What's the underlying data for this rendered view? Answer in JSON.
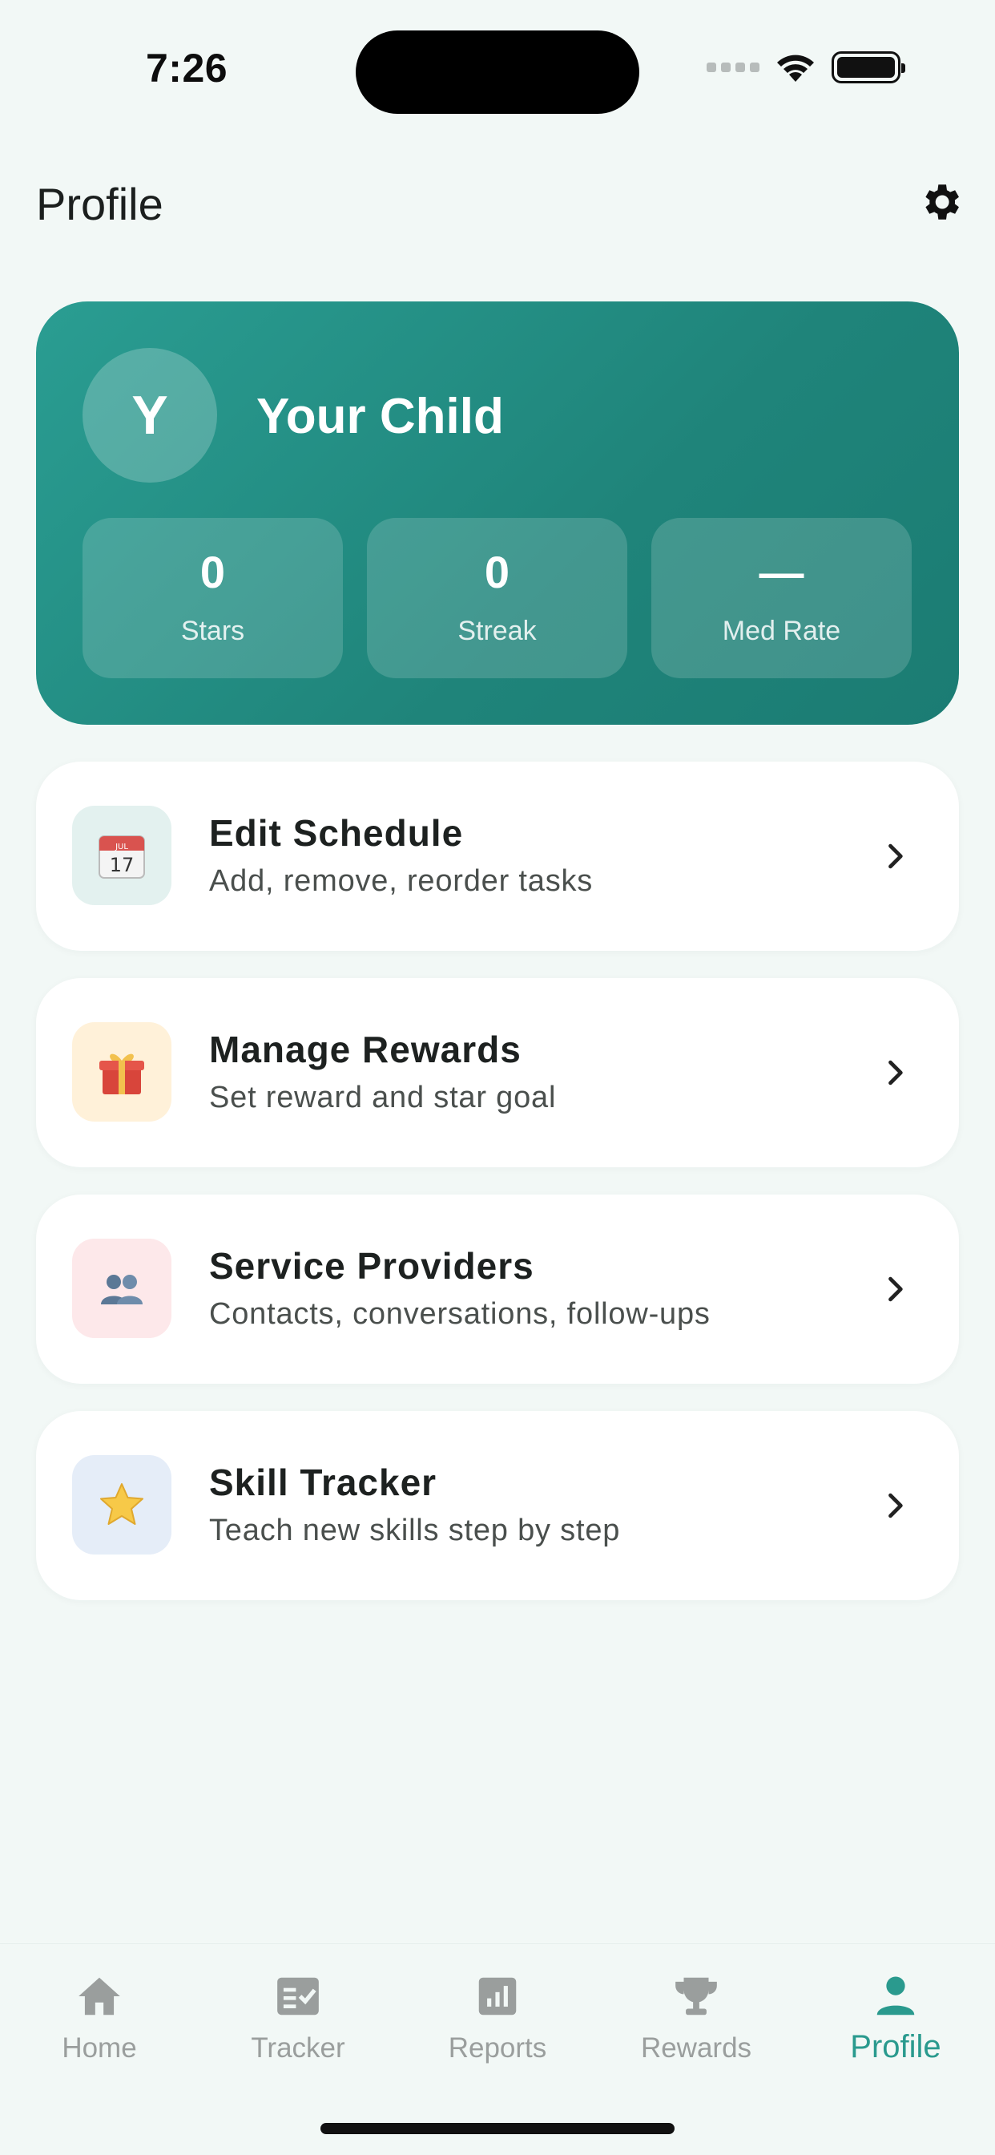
{
  "status_bar": {
    "time": "7:26"
  },
  "header": {
    "title": "Profile",
    "settings_icon": "gear-icon"
  },
  "profile": {
    "avatar_initial": "Y",
    "child_name": "Your Child",
    "stats": [
      {
        "value": "0",
        "label": "Stars"
      },
      {
        "value": "0",
        "label": "Streak"
      },
      {
        "value": "—",
        "label": "Med Rate"
      }
    ]
  },
  "menu": [
    {
      "title": "Edit Schedule",
      "subtitle": "Add, remove, reorder tasks",
      "icon": "calendar-icon",
      "icon_bg": "#e3f1ef"
    },
    {
      "title": "Manage Rewards",
      "subtitle": "Set reward and star goal",
      "icon": "gift-icon",
      "icon_bg": "#fff1d9"
    },
    {
      "title": "Service Providers",
      "subtitle": "Contacts, conversations, follow-ups",
      "icon": "people-icon",
      "icon_bg": "#fde8ea"
    },
    {
      "title": "Skill Tracker",
      "subtitle": "Teach new skills step by step",
      "icon": "star-icon",
      "icon_bg": "#e5edf8"
    }
  ],
  "tabs": [
    {
      "label": "Home",
      "icon": "home-icon",
      "active": false
    },
    {
      "label": "Tracker",
      "icon": "checklist-icon",
      "active": false
    },
    {
      "label": "Reports",
      "icon": "bar-chart-icon",
      "active": false
    },
    {
      "label": "Rewards",
      "icon": "trophy-icon",
      "active": false
    },
    {
      "label": "Profile",
      "icon": "person-icon",
      "active": true
    }
  ],
  "colors": {
    "accent": "#2a9a8e",
    "inactive": "#9a9e9d",
    "background": "#f2f8f6"
  }
}
